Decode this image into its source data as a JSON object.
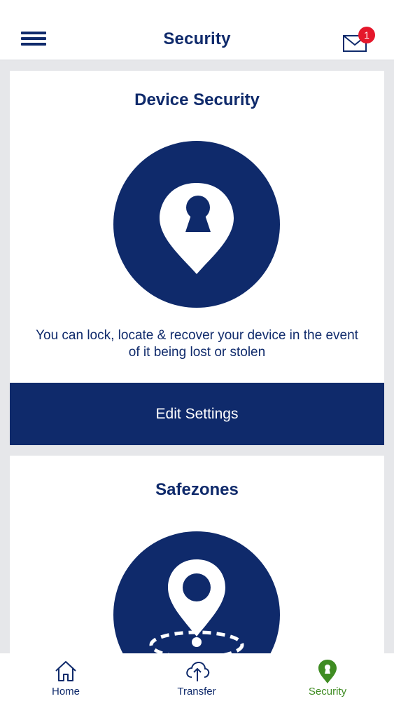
{
  "header": {
    "title": "Security",
    "notification_count": "1"
  },
  "cards": {
    "device_security": {
      "title": "Device Security",
      "description": "You can lock, locate & recover your device in the event of it being lost or stolen",
      "button_label": "Edit Settings"
    },
    "safezones": {
      "title": "Safezones"
    }
  },
  "bottom_nav": {
    "items": [
      {
        "label": "Home",
        "icon": "home-icon"
      },
      {
        "label": "Transfer",
        "icon": "cloud-upload-icon"
      },
      {
        "label": "Security",
        "icon": "location-keyhole-icon",
        "active": true
      }
    ]
  },
  "colors": {
    "primary": "#0f2a6b",
    "active": "#3f8c22",
    "badge": "#e5172b",
    "background": "#e6e7ea"
  }
}
